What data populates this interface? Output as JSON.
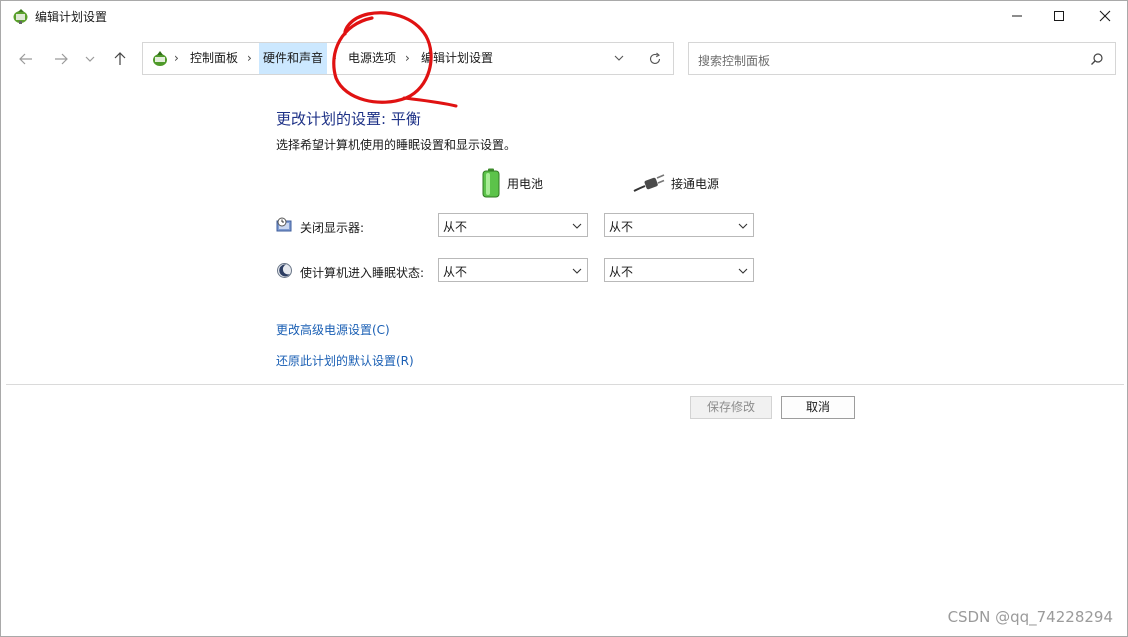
{
  "window": {
    "title": "编辑计划设置",
    "controls": {
      "minimize": "minimize",
      "maximize": "maximize",
      "close": "close"
    }
  },
  "nav": {
    "breadcrumb": [
      "控制面板",
      "硬件和声音",
      "电源选项",
      "编辑计划设置"
    ],
    "search_placeholder": "搜索控制面板"
  },
  "content": {
    "title": "更改计划的设置: 平衡",
    "description": "选择希望计算机使用的睡眠设置和显示设置。",
    "columns": {
      "battery": "用电池",
      "plugged": "接通电源"
    },
    "rows": [
      {
        "label": "关闭显示器:",
        "battery": "从不",
        "plugged": "从不"
      },
      {
        "label": "使计算机进入睡眠状态:",
        "battery": "从不",
        "plugged": "从不"
      }
    ],
    "links": {
      "advanced": "更改高级电源设置(C)",
      "restore": "还原此计划的默认设置(R)"
    },
    "buttons": {
      "save": "保存修改",
      "cancel": "取消"
    }
  },
  "watermark": "CSDN @qq_74228294",
  "colors": {
    "title_blue": "#1e3287",
    "link_blue": "#1a5fb4",
    "annotation_red": "#e01212",
    "hover_blue": "#cce8ff"
  }
}
